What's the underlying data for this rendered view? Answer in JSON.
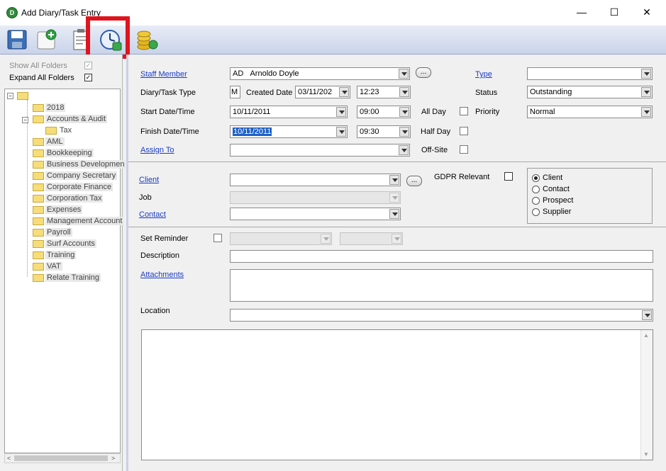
{
  "window": {
    "title": "Add Diary/Task Entry",
    "app_icon_letter": "D",
    "minimize": "—",
    "maximize": "☐",
    "close": "✕"
  },
  "toolbar": {
    "icons": [
      "save-icon",
      "add-new-icon",
      "clipboard-icon",
      "recurrence-clock-icon",
      "billing-coins-icon"
    ],
    "highlight_color": "#e0141e"
  },
  "left": {
    "show_all_folders": "Show All Folders",
    "show_all_checked": "✓",
    "expand_all_folders": "Expand All Folders",
    "expand_all_checked": "✓",
    "tree": [
      {
        "label": "2018"
      },
      {
        "label": "Accounts & Audit"
      },
      {
        "label": "Tax"
      },
      {
        "label": "AML"
      },
      {
        "label": "Bookkeeping"
      },
      {
        "label": "Business Developmen"
      },
      {
        "label": "Company Secretary"
      },
      {
        "label": "Corporate Finance"
      },
      {
        "label": "Corporation Tax"
      },
      {
        "label": "Expenses"
      },
      {
        "label": "Management Account"
      },
      {
        "label": "Payroll"
      },
      {
        "label": "Surf Accounts"
      },
      {
        "label": "Training"
      },
      {
        "label": "VAT"
      },
      {
        "label": "Relate Training"
      }
    ]
  },
  "form": {
    "staff_member_label": "Staff Member",
    "staff_initials": "AD",
    "staff_name": "Arnoldo Doyle",
    "ellipsis": "...",
    "type_label": "Type",
    "type_value": "",
    "task_type_label": "Diary/Task Type",
    "task_type_value": "M",
    "created_date_label": "Created Date",
    "created_date": "03/11/202",
    "created_time": "12:23",
    "status_label": "Status",
    "status_value": "Outstanding",
    "start_label": "Start Date/Time",
    "start_date": "10/11/2011",
    "start_time": "09:00",
    "all_day_label": "All Day",
    "priority_label": "Priority",
    "priority_value": "Normal",
    "finish_label": "Finish Date/Time",
    "finish_date": "10/11/2011",
    "finish_time": "09:30",
    "half_day_label": "Half Day",
    "assign_label": "Assign To",
    "offsite_label": "Off-Site",
    "client_label": "Client",
    "gdpr_label": "GDPR Relevant",
    "job_label": "Job",
    "contact_label": "Contact",
    "radio_options": [
      "Client",
      "Contact",
      "Prospect",
      "Supplier"
    ],
    "radio_selected": "Client",
    "reminder_label": "Set Reminder",
    "description_label": "Description",
    "attachments_label": "Attachments",
    "location_label": "Location"
  }
}
